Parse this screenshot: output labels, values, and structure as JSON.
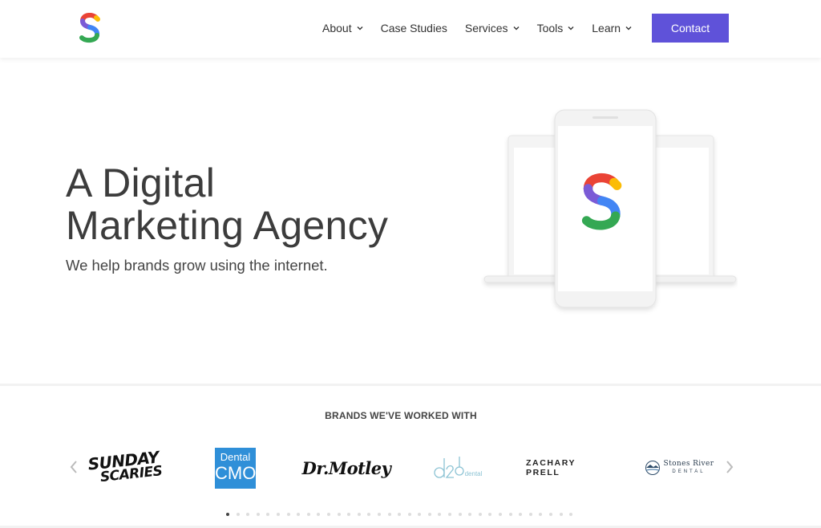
{
  "header": {
    "logo_icon": "s-logo-icon",
    "nav": [
      {
        "label": "About",
        "has_dropdown": true
      },
      {
        "label": "Case Studies",
        "has_dropdown": false
      },
      {
        "label": "Services",
        "has_dropdown": true
      },
      {
        "label": "Tools",
        "has_dropdown": true
      },
      {
        "label": "Learn",
        "has_dropdown": true
      }
    ],
    "contact_label": "Contact"
  },
  "hero": {
    "title_line1": "A Digital",
    "title_line2": "Marketing Agency",
    "subtitle": "We help brands grow using the internet."
  },
  "brands": {
    "title": "BRANDS WE'VE WORKED WITH",
    "logos": [
      {
        "name": "Sunday Scaries",
        "line1": "SUNDAY",
        "line2": "SCARIES"
      },
      {
        "name": "Dental CMO",
        "line1": "Dental",
        "line2": "CMO"
      },
      {
        "name": "Dr. Motley",
        "text": "Dr.Motley"
      },
      {
        "name": "d2o dental",
        "text": "dental"
      },
      {
        "name": "Zachary Prell",
        "text": "ZACHARY PRELL"
      },
      {
        "name": "Stones River Dental",
        "line1": "Stones River",
        "line2": "DENTAL"
      }
    ],
    "carousel_pages": 35,
    "active_page": 1
  },
  "colors": {
    "accent": "#5f52d9",
    "logo_red": "#ea4335",
    "logo_yellow": "#fbbc05",
    "logo_green": "#34a853",
    "logo_blue": "#4285f4",
    "logo_purple": "#7b5bd6"
  }
}
